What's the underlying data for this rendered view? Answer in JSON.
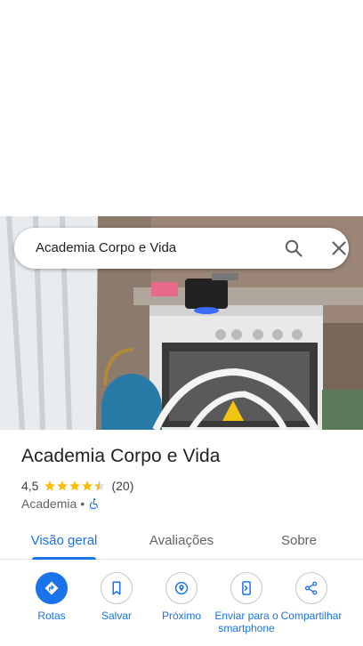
{
  "search": {
    "query": "Academia Corpo e Vida"
  },
  "place": {
    "title": "Academia Corpo e Vida",
    "rating": "4,5",
    "review_count": "(20)",
    "stars_filled": 4.5,
    "category": "Academia",
    "separator": "•"
  },
  "tabs": [
    {
      "label": "Visão geral",
      "active": true
    },
    {
      "label": "Avaliações",
      "active": false
    },
    {
      "label": "Sobre",
      "active": false
    }
  ],
  "actions": [
    {
      "label": "Rotas",
      "icon": "directions-icon"
    },
    {
      "label": "Salvar",
      "icon": "bookmark-icon"
    },
    {
      "label": "Próximo",
      "icon": "nearby-icon"
    },
    {
      "label": "Enviar para o smartphone",
      "icon": "send-to-phone-icon"
    },
    {
      "label": "Compartilhar",
      "icon": "share-icon"
    }
  ],
  "colors": {
    "accent": "#1a73e8",
    "star": "#fbbc04"
  }
}
